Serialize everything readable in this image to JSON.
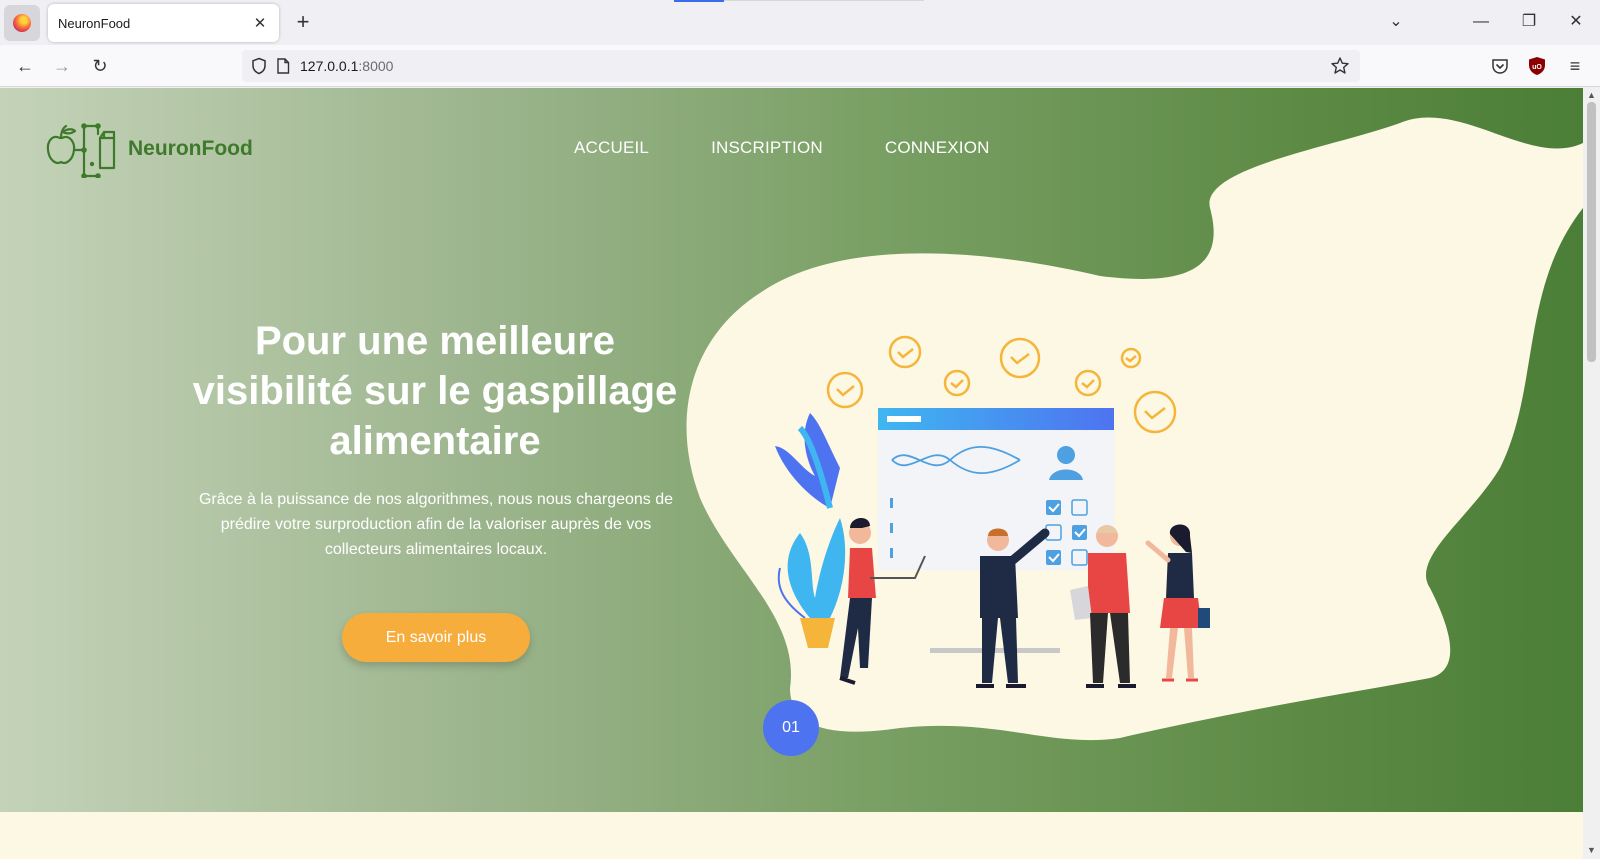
{
  "browser": {
    "tab_title": "NeuronFood",
    "tab_close": "✕",
    "new_tab": "+",
    "url_host": "127.0.0.1",
    "url_port": ":8000",
    "win_list": "⌄",
    "win_minimize": "—",
    "win_restore": "❐",
    "win_close": "✕",
    "back": "←",
    "forward": "→",
    "reload": "↻",
    "menu": "≡"
  },
  "site": {
    "brand": "NeuronFood",
    "nav": [
      "ACCUEIL",
      "INSCRIPTION",
      "CONNEXION"
    ],
    "headline": "Pour une meilleure visibilité sur le gaspillage alimentaire",
    "subtext": "Grâce à la puissance de nos algorithmes, nous nous chargeons de prédire votre surproduction afin de la valoriser auprès de vos collecteurs alimentaires locaux.",
    "cta": "En savoir plus",
    "slide_number": "01"
  },
  "colors": {
    "brand_green": "#3f7a2c",
    "cta_orange": "#f7ad3c",
    "badge_blue": "#4e73f0",
    "blob_cream": "#fdf8e4"
  }
}
